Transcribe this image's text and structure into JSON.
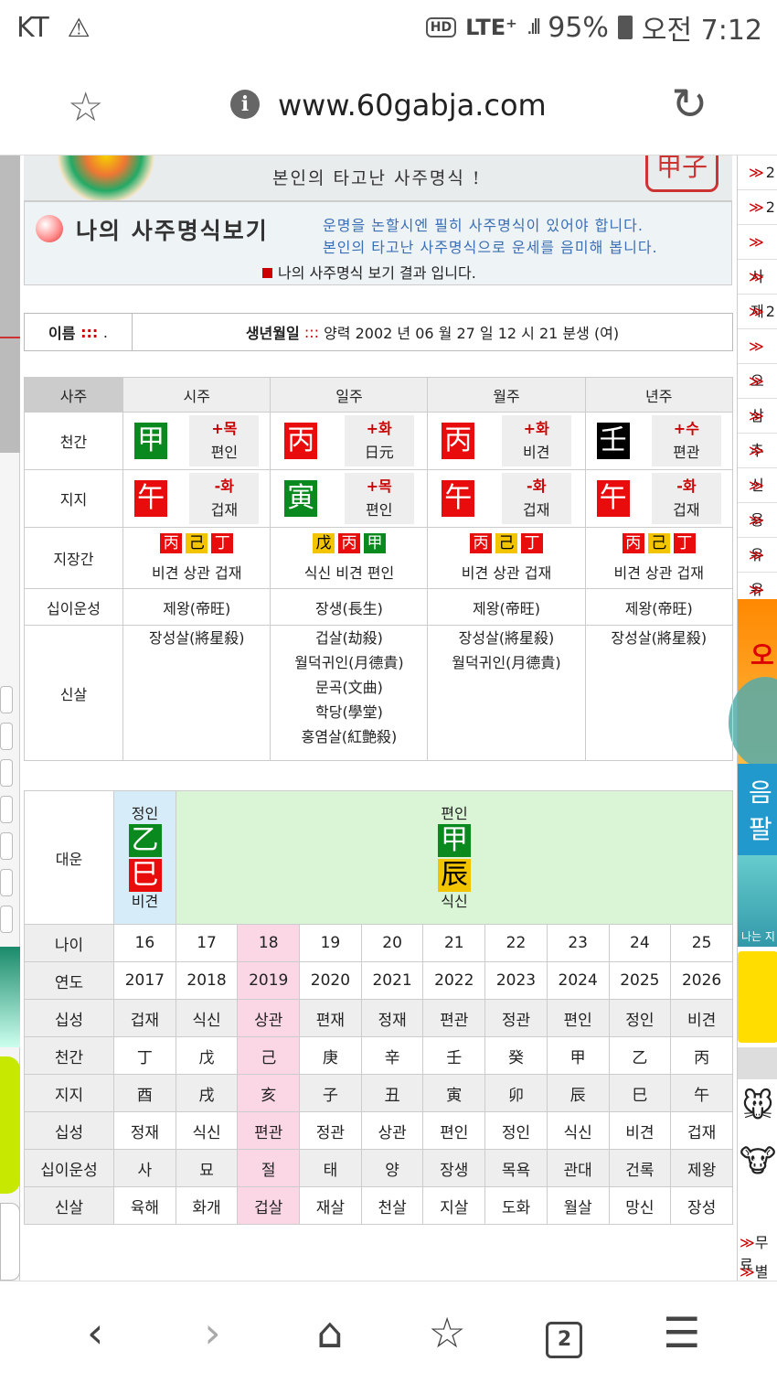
{
  "status": {
    "carrier": "KT",
    "warning": "⚠",
    "hd": "HD",
    "network": "LTE⁺",
    "signal": ".ıll",
    "battery": "95%",
    "time": "오전 7:12"
  },
  "browser": {
    "url": "www.60gabja.com"
  },
  "right_sidebar": {
    "items": [
      "2",
      "2",
      "사",
      "재",
      "2",
      "오",
      "삼",
      "추",
      "신",
      "용",
      "유",
      "유",
      "삼"
    ],
    "ad_text": "음 팔",
    "ad3_text": "나는 지",
    "bottom": [
      "무료",
      "별자"
    ]
  },
  "banner": {
    "tagline": "본인의 타고난 사주명식 !",
    "seal": "甲子",
    "title": "나의 사주명식보기",
    "note1": "운명을 논할시엔 필히 사주명식이 있어야 합니다.",
    "note2": "본인의 타고난 사주명식으로 운세를 음미해 봅니다.",
    "result": "나의 사주명식 보기 결과 입니다."
  },
  "info": {
    "name_label": "이름",
    "name_sep": ":::",
    "name_value": ".",
    "birth_label": "생년월일",
    "birth_sep": ":::",
    "birth_value": "양력 2002 년 06 월 27 일 12 시 21 분생 (여)"
  },
  "saju": {
    "corner": "사주",
    "columns": [
      "시주",
      "일주",
      "월주",
      "년주"
    ],
    "row_labels": {
      "cheongan": "천간",
      "jiji": "지지",
      "jijanggan": "지장간",
      "sibiun": "십이운성",
      "shinsal": "신살"
    },
    "cheongan": [
      {
        "char": "甲",
        "color": "#0a8a1e",
        "sign": "+목",
        "rel": "편인"
      },
      {
        "char": "丙",
        "color": "#e80c0c",
        "sign": "+화",
        "rel": "日元"
      },
      {
        "char": "丙",
        "color": "#e80c0c",
        "sign": "+화",
        "rel": "비견"
      },
      {
        "char": "壬",
        "color": "#000000",
        "sign": "+수",
        "rel": "편관"
      }
    ],
    "jiji": [
      {
        "char": "午",
        "color": "#e80c0c",
        "sign": "-화",
        "rel": "겁재"
      },
      {
        "char": "寅",
        "color": "#0a8a1e",
        "sign": "+목",
        "rel": "편인"
      },
      {
        "char": "午",
        "color": "#e80c0c",
        "sign": "-화",
        "rel": "겁재"
      },
      {
        "char": "午",
        "color": "#e80c0c",
        "sign": "-화",
        "rel": "겁재"
      }
    ],
    "jijanggan": [
      {
        "stems": [
          {
            "c": "丙",
            "bg": "#e80c0c",
            "fg": "#fff"
          },
          {
            "c": "己",
            "bg": "#f2c500",
            "fg": "#000"
          },
          {
            "c": "丁",
            "bg": "#e80c0c",
            "fg": "#fff"
          }
        ],
        "text": "비견 상관 겁재"
      },
      {
        "stems": [
          {
            "c": "戊",
            "bg": "#f2c500",
            "fg": "#000"
          },
          {
            "c": "丙",
            "bg": "#e80c0c",
            "fg": "#fff"
          },
          {
            "c": "甲",
            "bg": "#0a8a1e",
            "fg": "#fff"
          }
        ],
        "text": "식신 비견 편인"
      },
      {
        "stems": [
          {
            "c": "丙",
            "bg": "#e80c0c",
            "fg": "#fff"
          },
          {
            "c": "己",
            "bg": "#f2c500",
            "fg": "#000"
          },
          {
            "c": "丁",
            "bg": "#e80c0c",
            "fg": "#fff"
          }
        ],
        "text": "비견 상관 겁재"
      },
      {
        "stems": [
          {
            "c": "丙",
            "bg": "#e80c0c",
            "fg": "#fff"
          },
          {
            "c": "己",
            "bg": "#f2c500",
            "fg": "#000"
          },
          {
            "c": "丁",
            "bg": "#e80c0c",
            "fg": "#fff"
          }
        ],
        "text": "비견 상관 겁재"
      }
    ],
    "sibiun": [
      "제왕(帝旺)",
      "장생(長生)",
      "제왕(帝旺)",
      "제왕(帝旺)"
    ],
    "shinsal": [
      [
        "장성살(將星殺)"
      ],
      [
        "겁살(劫殺)",
        "월덕귀인(月德貴)",
        "문곡(文曲)",
        "학당(學堂)",
        "홍염살(紅艶殺)"
      ],
      [
        "장성살(將星殺)",
        "월덕귀인(月德貴)"
      ],
      [
        "장성살(將星殺)"
      ]
    ]
  },
  "daewoon": {
    "label": "대운",
    "left": {
      "top": "정인",
      "stem": "乙",
      "stem_bg": "#0a8a1e",
      "stem_fg": "#fff",
      "branch": "巳",
      "branch_bg": "#e80c0c",
      "branch_fg": "#fff",
      "bottom": "비견"
    },
    "right": {
      "top": "편인",
      "stem": "甲",
      "stem_bg": "#0a8a1e",
      "stem_fg": "#fff",
      "branch": "辰",
      "branch_bg": "#f2c500",
      "branch_fg": "#000",
      "bottom": "식신"
    }
  },
  "years": {
    "rows": [
      {
        "label": "나이",
        "cells": [
          "16",
          "17",
          "18",
          "19",
          "20",
          "21",
          "22",
          "23",
          "24",
          "25"
        ]
      },
      {
        "label": "연도",
        "cells": [
          "2017",
          "2018",
          "2019",
          "2020",
          "2021",
          "2022",
          "2023",
          "2024",
          "2025",
          "2026"
        ]
      },
      {
        "label": "십성",
        "cells": [
          "겁재",
          "식신",
          "상관",
          "편재",
          "정재",
          "편관",
          "정관",
          "편인",
          "정인",
          "비견"
        ]
      },
      {
        "label": "천간",
        "cells": [
          "丁",
          "戊",
          "己",
          "庚",
          "辛",
          "壬",
          "癸",
          "甲",
          "乙",
          "丙"
        ]
      },
      {
        "label": "지지",
        "cells": [
          "酉",
          "戌",
          "亥",
          "子",
          "丑",
          "寅",
          "卯",
          "辰",
          "巳",
          "午"
        ]
      },
      {
        "label": "십성",
        "cells": [
          "정재",
          "식신",
          "편관",
          "정관",
          "상관",
          "편인",
          "정인",
          "식신",
          "비견",
          "겁재"
        ]
      },
      {
        "label": "십이운성",
        "cells": [
          "사",
          "묘",
          "절",
          "태",
          "양",
          "장생",
          "목욕",
          "관대",
          "건록",
          "제왕"
        ]
      },
      {
        "label": "신살",
        "cells": [
          "육해",
          "화개",
          "겁살",
          "재살",
          "천살",
          "지살",
          "도화",
          "월살",
          "망신",
          "장성"
        ]
      }
    ],
    "highlight_col": 2
  },
  "nav": {
    "back": "‹",
    "forward": "›",
    "home": "⌂",
    "bookmark": "☆",
    "tabs": "2",
    "menu": "☰"
  }
}
